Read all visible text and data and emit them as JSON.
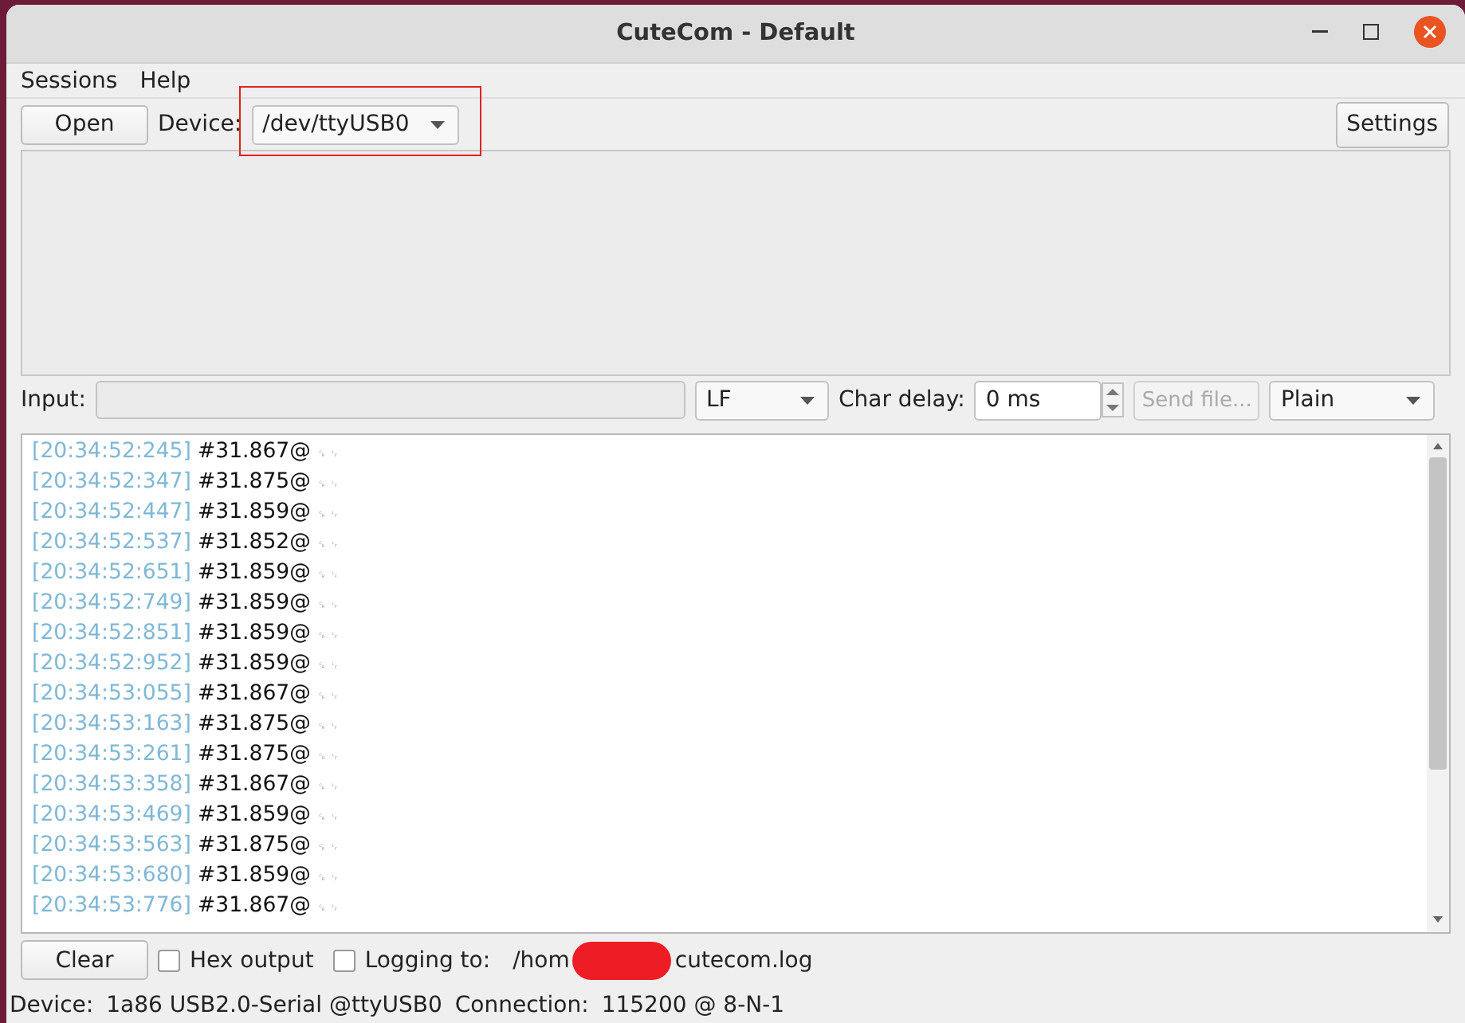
{
  "window": {
    "title": "CuteCom - Default"
  },
  "menu": [
    "Sessions",
    "Help"
  ],
  "toolbar": {
    "open_button": "Open",
    "device_label": "Device:",
    "device_value": "/dev/ttyUSB0",
    "settings_button": "Settings"
  },
  "input_row": {
    "label": "Input:",
    "line_ending": "LF",
    "char_delay_label": "Char delay:",
    "char_delay_value": "0 ms",
    "send_file_button": "Send file...",
    "send_file_disabled": true,
    "format": "Plain"
  },
  "log": [
    {
      "time": "[20:34:52:245]",
      "text": "#31.867@",
      "suffix": "␍␊"
    },
    {
      "time": "[20:34:52:347]",
      "text": "#31.875@",
      "suffix": "␍␊"
    },
    {
      "time": "[20:34:52:447]",
      "text": "#31.859@",
      "suffix": "␍␊"
    },
    {
      "time": "[20:34:52:537]",
      "text": "#31.852@",
      "suffix": "␍␊"
    },
    {
      "time": "[20:34:52:651]",
      "text": "#31.859@",
      "suffix": "␍␊"
    },
    {
      "time": "[20:34:52:749]",
      "text": "#31.859@",
      "suffix": "␍␊"
    },
    {
      "time": "[20:34:52:851]",
      "text": "#31.859@",
      "suffix": "␍␊"
    },
    {
      "time": "[20:34:52:952]",
      "text": "#31.859@",
      "suffix": "␍␊"
    },
    {
      "time": "[20:34:53:055]",
      "text": "#31.867@",
      "suffix": "␍␊"
    },
    {
      "time": "[20:34:53:163]",
      "text": "#31.875@",
      "suffix": "␍␊"
    },
    {
      "time": "[20:34:53:261]",
      "text": "#31.875@",
      "suffix": "␍␊"
    },
    {
      "time": "[20:34:53:358]",
      "text": "#31.867@",
      "suffix": "␍␊"
    },
    {
      "time": "[20:34:53:469]",
      "text": "#31.859@",
      "suffix": "␍␊"
    },
    {
      "time": "[20:34:53:563]",
      "text": "#31.875@",
      "suffix": "␍␊"
    },
    {
      "time": "[20:34:53:680]",
      "text": "#31.859@",
      "suffix": "␍␊"
    },
    {
      "time": "[20:34:53:776]",
      "text": "#31.867@",
      "suffix": "␍␊"
    }
  ],
  "bottom_row": {
    "clear_button": "Clear",
    "hex_output": {
      "label": "Hex output",
      "checked": false
    },
    "logging": {
      "label": "Logging to:",
      "checked": false
    },
    "log_path_start": "/hom",
    "log_path_end": "cutecom.log"
  },
  "status_bar": {
    "device_label": "Device:",
    "device_value": "1a86 USB2.0-Serial @ttyUSB0",
    "connection_label": "Connection:",
    "connection_value": "115200 @ 8-N-1"
  }
}
